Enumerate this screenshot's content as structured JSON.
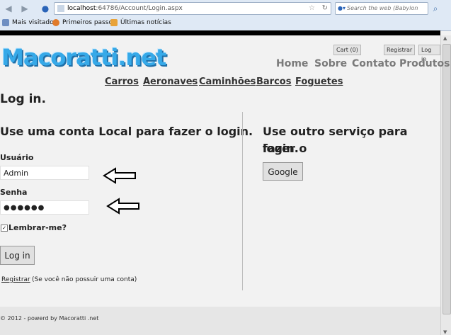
{
  "browser": {
    "url_host": "localhost",
    "url_path": ":64786/Account/Login.aspx",
    "search_placeholder": "Search the web (Babylon",
    "bookmarks": [
      "Mais visitados",
      "Primeiros passos",
      "Últimas notícias"
    ]
  },
  "header": {
    "logo": "Macoratti.net",
    "cart": "Cart (0)",
    "register": "Registrar",
    "login": "Log in",
    "nav": [
      "Home",
      "Sobre",
      "Contato",
      "Produtos"
    ],
    "categories": [
      "Carros",
      "Aeronaves",
      "Caminhões",
      "Barcos",
      "Foguetes"
    ]
  },
  "main": {
    "title": "Log in.",
    "local_heading": "Use uma conta Local para fazer o login.",
    "user_label": "Usuário",
    "user_value": "Admin",
    "password_label": "Senha",
    "password_value": "●●●●●●",
    "remember_label": "Lembrar-me?",
    "login_button": "Log in",
    "register_link": "Registrar",
    "register_note": "(Se você não possuir uma conta)",
    "external_heading_1": "Use outro serviço para fazer o",
    "external_heading_2": "login.",
    "google_button": "Google"
  },
  "footer": {
    "text": "© 2012 - powerd by Macoratti .net"
  }
}
